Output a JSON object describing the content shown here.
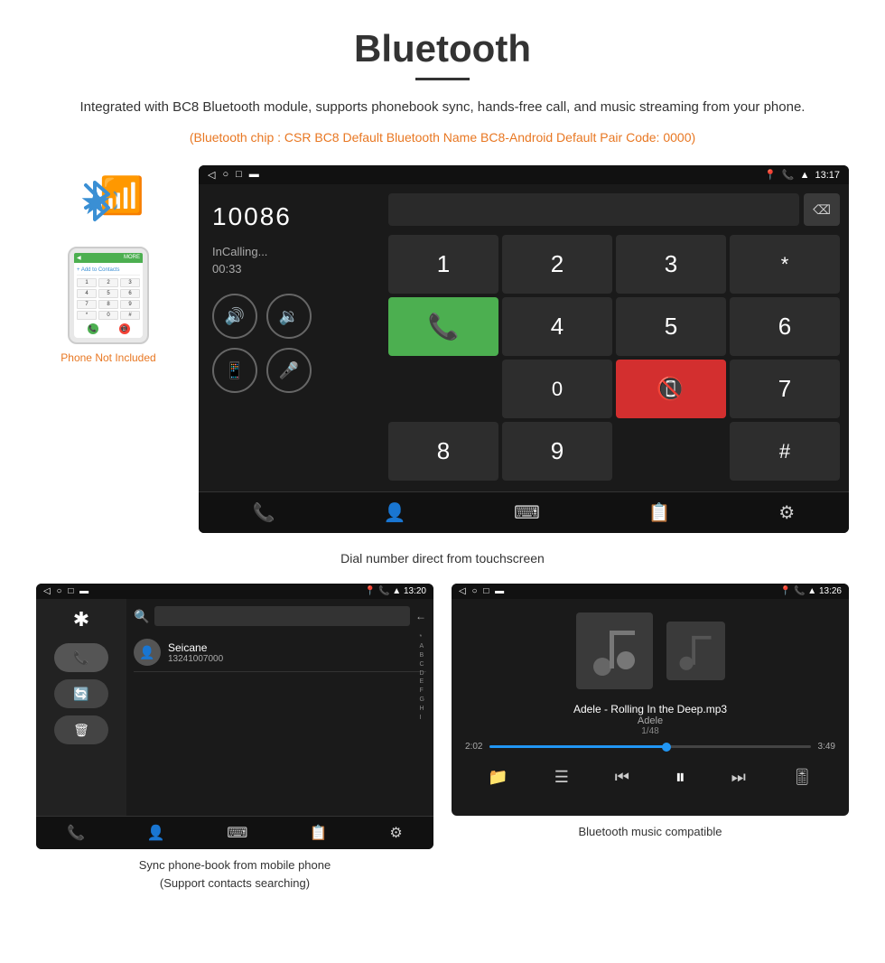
{
  "page": {
    "title": "Bluetooth",
    "description": "Integrated with BC8 Bluetooth module, supports phonebook sync, hands-free call, and music streaming from your phone.",
    "orange_note": "(Bluetooth chip : CSR BC8    Default Bluetooth Name BC8-Android    Default Pair Code: 0000)"
  },
  "dial_screen": {
    "status_time": "13:17",
    "call_number": "10086",
    "call_status": "InCalling...",
    "call_timer": "00:33",
    "caption": "Dial number direct from touchscreen",
    "keys": [
      "1",
      "2",
      "3",
      "*",
      "4",
      "5",
      "6",
      "0",
      "7",
      "8",
      "9",
      "#"
    ]
  },
  "phonebook_screen": {
    "status_time": "13:20",
    "contact_name": "Seicane",
    "contact_phone": "13241007000",
    "caption_line1": "Sync phone-book from mobile phone",
    "caption_line2": "(Support contacts searching)",
    "alphabet": [
      "A",
      "B",
      "C",
      "D",
      "E",
      "F",
      "G",
      "H",
      "I"
    ]
  },
  "music_screen": {
    "status_time": "13:26",
    "song_title": "Adele - Rolling In the Deep.mp3",
    "artist": "Adele",
    "track_count": "1/48",
    "time_elapsed": "2:02",
    "time_total": "3:49",
    "caption": "Bluetooth music compatible"
  },
  "phone_illustration": {
    "not_included_text": "Phone Not Included"
  }
}
